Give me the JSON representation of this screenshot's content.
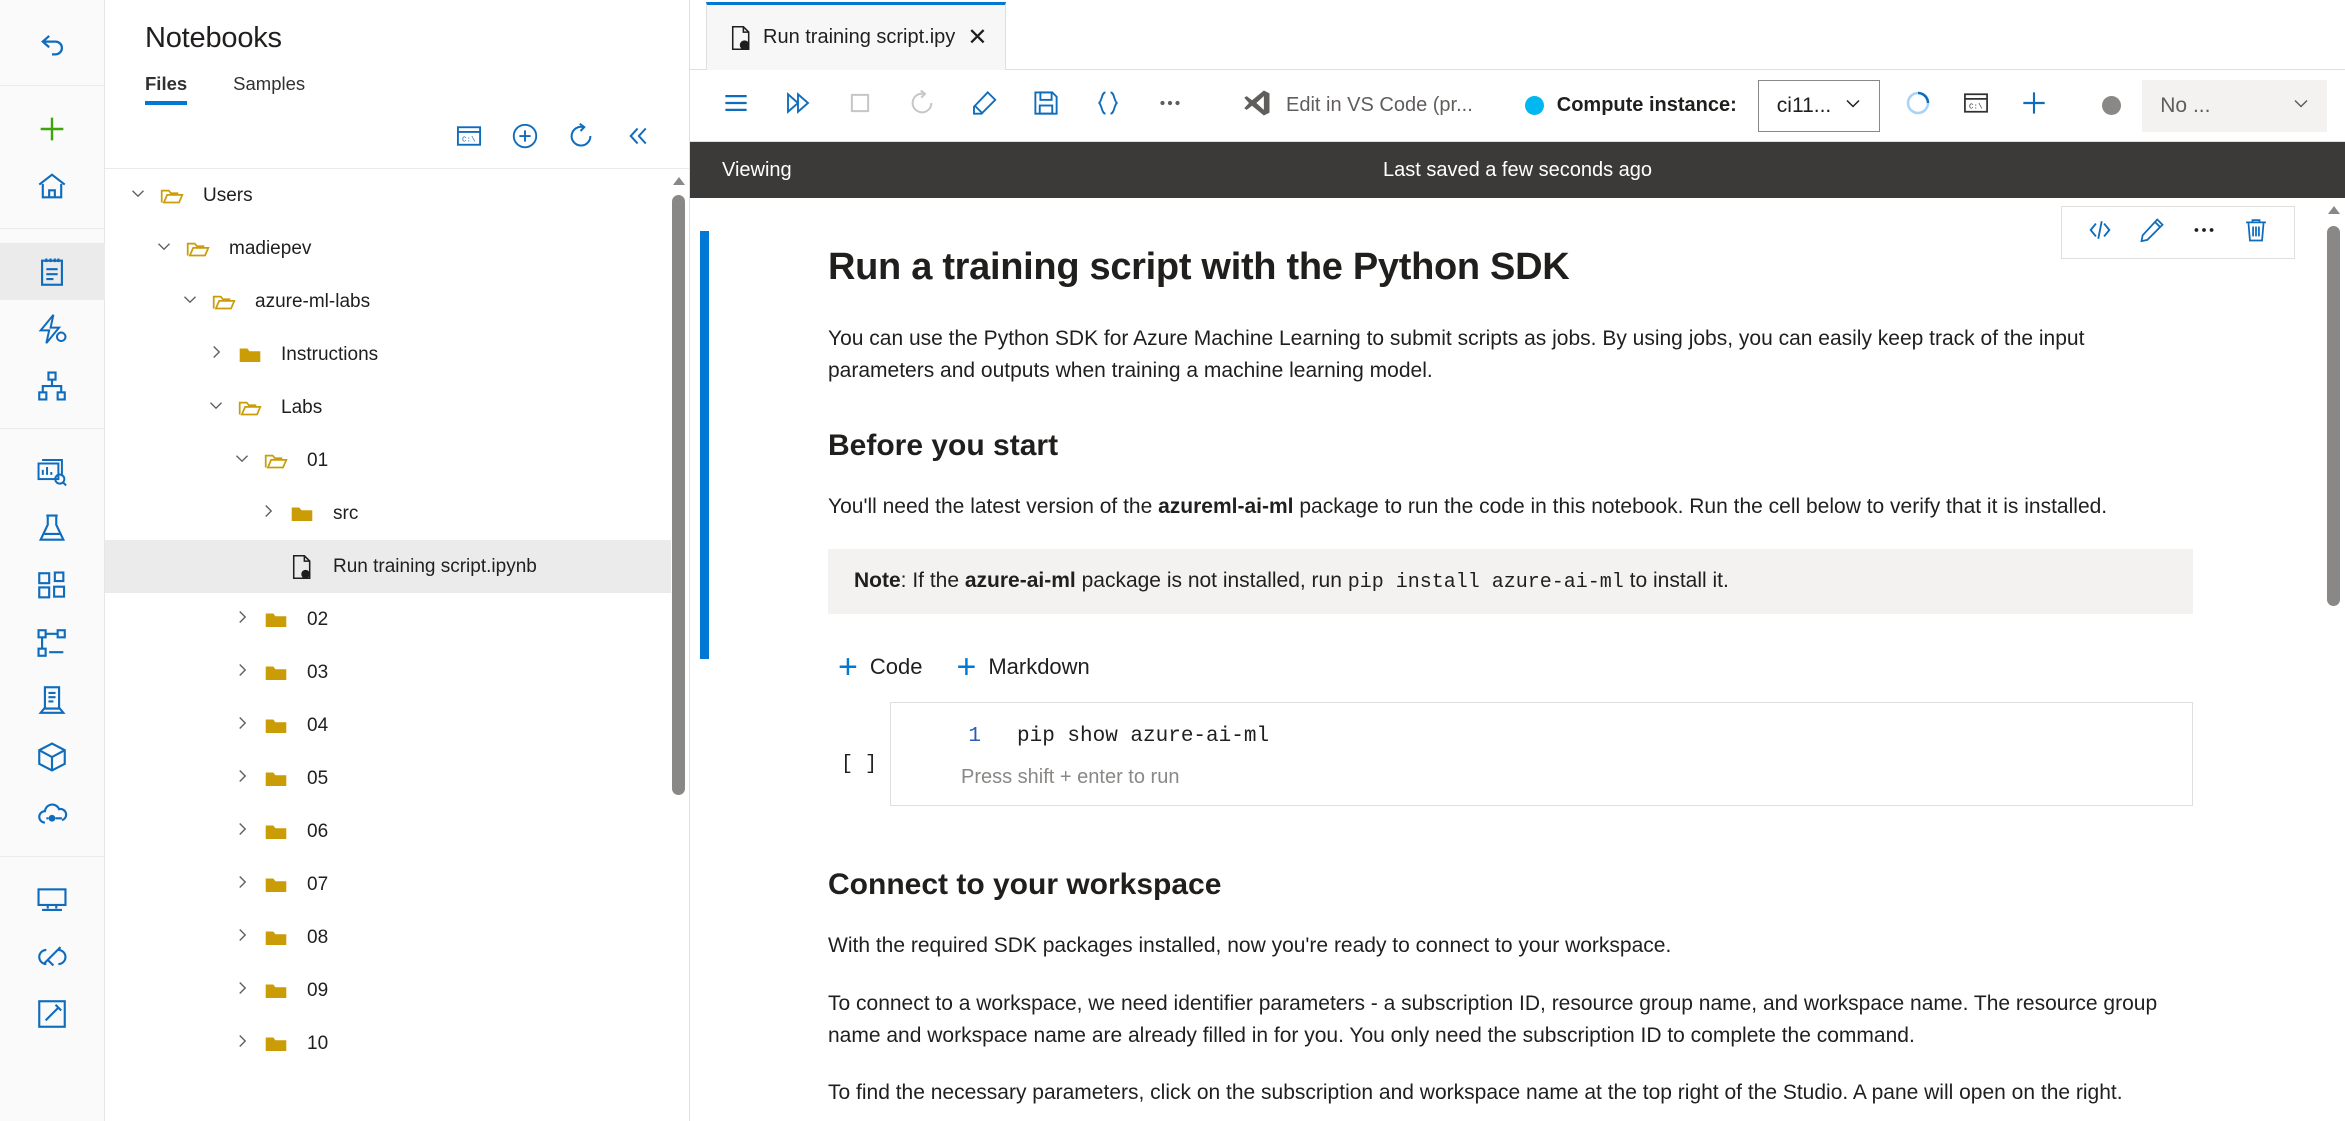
{
  "rail": {
    "groups": [
      {
        "items": [
          {
            "icon": "back-arrow-icon",
            "name": "back-button",
            "selected": false
          }
        ]
      },
      {
        "items": [
          {
            "icon": "plus-icon",
            "name": "new-button",
            "selected": false
          },
          {
            "icon": "home-icon",
            "name": "home-button",
            "selected": false
          }
        ]
      },
      {
        "items": [
          {
            "icon": "notebook-icon",
            "name": "notebooks-button",
            "selected": true
          },
          {
            "icon": "automated-ml-icon",
            "name": "automated-ml-button",
            "selected": false
          },
          {
            "icon": "designer-icon",
            "name": "designer-button",
            "selected": false
          }
        ]
      },
      {
        "items": [
          {
            "icon": "data-monitoring-icon",
            "name": "jobs-button",
            "selected": false
          },
          {
            "icon": "flask-icon",
            "name": "experiments-button",
            "selected": false
          },
          {
            "icon": "components-icon",
            "name": "components-button",
            "selected": false
          },
          {
            "icon": "pipelines-icon",
            "name": "pipelines-button",
            "selected": false
          },
          {
            "icon": "data-icon",
            "name": "data-button",
            "selected": false
          },
          {
            "icon": "cube-icon",
            "name": "models-button",
            "selected": false
          },
          {
            "icon": "endpoints-cloud-icon",
            "name": "endpoints-button",
            "selected": false
          }
        ]
      },
      {
        "items": [
          {
            "icon": "compute-monitor-icon",
            "name": "compute-button",
            "selected": false
          },
          {
            "icon": "linked-services-icon",
            "name": "linked-services-button",
            "selected": false
          },
          {
            "icon": "data-labeling-icon",
            "name": "data-labeling-button",
            "selected": false
          }
        ]
      }
    ]
  },
  "explorer": {
    "title": "Notebooks",
    "tabs": [
      {
        "label": "Files",
        "active": true
      },
      {
        "label": "Samples",
        "active": false
      }
    ],
    "toolbar": [
      {
        "icon": "terminal-icon",
        "name": "open-terminal-button",
        "label": "C:\\"
      },
      {
        "icon": "add-circle-icon",
        "name": "create-new-file-button"
      },
      {
        "icon": "refresh-icon",
        "name": "refresh-button"
      },
      {
        "icon": "double-chevron-left-icon",
        "name": "collapse-panel-button"
      }
    ],
    "tree": [
      {
        "label": "Users",
        "indent": 0,
        "chevron": "down",
        "icon": "folder-open-icon",
        "selected": false
      },
      {
        "label": "madiepev",
        "indent": 1,
        "chevron": "down",
        "icon": "folder-open-icon",
        "selected": false
      },
      {
        "label": "azure-ml-labs",
        "indent": 2,
        "chevron": "down",
        "icon": "folder-open-icon",
        "selected": false
      },
      {
        "label": "Instructions",
        "indent": 3,
        "chevron": "right",
        "icon": "folder-closed-icon",
        "selected": false
      },
      {
        "label": "Labs",
        "indent": 3,
        "chevron": "down",
        "icon": "folder-open-icon",
        "selected": false
      },
      {
        "label": "01",
        "indent": 4,
        "chevron": "down",
        "icon": "folder-open-icon",
        "selected": false
      },
      {
        "label": "src",
        "indent": 5,
        "chevron": "right",
        "icon": "folder-closed-icon",
        "selected": false
      },
      {
        "label": "Run training script.ipynb",
        "indent": 5,
        "chevron": "none",
        "icon": "notebook-file-icon",
        "selected": true
      },
      {
        "label": "02",
        "indent": 4,
        "chevron": "right",
        "icon": "folder-closed-icon",
        "selected": false
      },
      {
        "label": "03",
        "indent": 4,
        "chevron": "right",
        "icon": "folder-closed-icon",
        "selected": false
      },
      {
        "label": "04",
        "indent": 4,
        "chevron": "right",
        "icon": "folder-closed-icon",
        "selected": false
      },
      {
        "label": "05",
        "indent": 4,
        "chevron": "right",
        "icon": "folder-closed-icon",
        "selected": false
      },
      {
        "label": "06",
        "indent": 4,
        "chevron": "right",
        "icon": "folder-closed-icon",
        "selected": false
      },
      {
        "label": "07",
        "indent": 4,
        "chevron": "right",
        "icon": "folder-closed-icon",
        "selected": false
      },
      {
        "label": "08",
        "indent": 4,
        "chevron": "right",
        "icon": "folder-closed-icon",
        "selected": false
      },
      {
        "label": "09",
        "indent": 4,
        "chevron": "right",
        "icon": "folder-closed-icon",
        "selected": false
      },
      {
        "label": "10",
        "indent": 4,
        "chevron": "right",
        "icon": "folder-closed-icon",
        "selected": false
      }
    ]
  },
  "notebook": {
    "tab": {
      "name": "Run training script.ipy",
      "close": "✕"
    },
    "toolbar": {
      "buttons": [
        {
          "icon": "menu-icon",
          "name": "toc-menu-button",
          "state": "active"
        },
        {
          "icon": "run-all-icon",
          "name": "run-all-button",
          "state": "active"
        },
        {
          "icon": "stop-icon",
          "name": "stop-button",
          "state": "disabled"
        },
        {
          "icon": "restart-icon",
          "name": "restart-kernel-button",
          "state": "disabled"
        },
        {
          "icon": "clear-output-icon",
          "name": "clear-output-button",
          "state": "active"
        },
        {
          "icon": "save-icon",
          "name": "save-button",
          "state": "active"
        },
        {
          "icon": "braces-icon",
          "name": "format-button",
          "state": "active"
        },
        {
          "icon": "ellipsis-icon",
          "name": "more-options-button",
          "state": "active"
        }
      ],
      "vscode": {
        "label": "Edit in VS Code (pr...",
        "icon": "vscode-icon"
      },
      "compute_label": "Compute instance:",
      "compute_value": "ci11...",
      "compute_status_color": "#00b7f1",
      "right_buttons": [
        {
          "icon": "kernel-idle-icon",
          "name": "kernel-status-button"
        },
        {
          "icon": "terminal-icon",
          "name": "compute-terminal-button"
        },
        {
          "icon": "plus-icon",
          "name": "new-compute-button"
        }
      ],
      "kernel_value": "No ...",
      "kernel_status_color": "#8a8886"
    },
    "status": {
      "mode": "Viewing",
      "saved": "Last saved a few seconds ago"
    },
    "cell_actions": [
      {
        "icon": "code-brackets-icon",
        "name": "view-source-button"
      },
      {
        "icon": "pencil-icon",
        "name": "edit-cell-button"
      },
      {
        "icon": "ellipsis-icon",
        "name": "cell-more-button"
      },
      {
        "icon": "trash-icon",
        "name": "delete-cell-button"
      }
    ],
    "content": {
      "h1": "Run a training script with the Python SDK",
      "p1": "You can use the Python SDK for Azure Machine Learning to submit scripts as jobs. By using jobs, you can easily keep track of the input parameters and outputs when training a machine learning model.",
      "h2_before": "Before you start",
      "p2_a": "You'll need the latest version of the ",
      "p2_b": "azureml-ai-ml",
      "p2_c": " package to run the code in this notebook. Run the cell below to verify that it is installed.",
      "note_label": "Note",
      "note_a": ": If the ",
      "note_pkg": "azure-ai-ml",
      "note_b": " package is not installed, run ",
      "note_code": "pip install azure-ai-ml",
      "note_c": " to install it.",
      "add_code": "Code",
      "add_markdown": "Markdown",
      "cell": {
        "execution_count": "[ ]",
        "line_number": "1",
        "code": "pip show azure-ai-ml",
        "hint": "Press shift + enter to run"
      },
      "h2_connect": "Connect to your workspace",
      "p3": "With the required SDK packages installed, now you're ready to connect to your workspace.",
      "p4": "To connect to a workspace, we need identifier parameters - a subscription ID, resource group name, and workspace name. The resource group name and workspace name are already filled in for you. You only need the subscription ID to complete the command.",
      "p5": "To find the necessary parameters, click on the subscription and workspace name at the top right of the Studio. A pane will open on the right."
    }
  },
  "colors": {
    "accent": "#0078d4",
    "folder": "#ca9c06",
    "statusbar": "#3b3a39",
    "selection": "#ebebeb"
  }
}
